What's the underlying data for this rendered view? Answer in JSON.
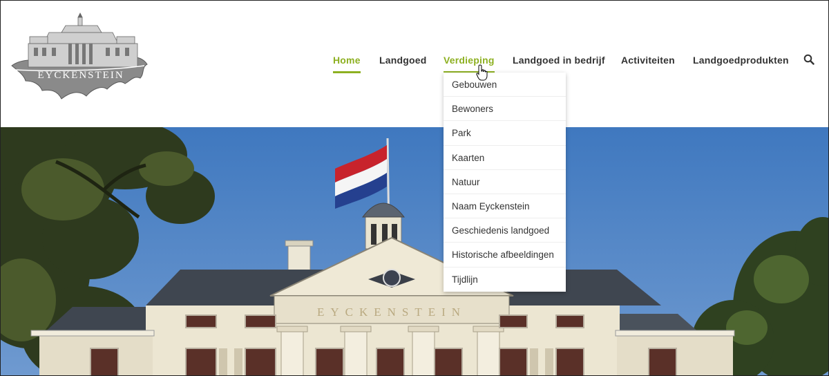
{
  "logo": {
    "text": "EYCKENSTEIN"
  },
  "nav": {
    "items": [
      {
        "label": "Home",
        "active": true
      },
      {
        "label": "Landgoed",
        "active": false
      },
      {
        "label": "Verdieping",
        "active": true
      },
      {
        "label": "Landgoed in bedrijf",
        "active": false
      },
      {
        "label": "Activiteiten",
        "active": false
      },
      {
        "label": "Landgoedprodukten",
        "active": false
      }
    ],
    "search_icon": "search-icon"
  },
  "dropdown": {
    "items": [
      "Gebouwen",
      "Bewoners",
      "Park",
      "Kaarten",
      "Natuur",
      "Naam Eyckenstein",
      "Geschiedenis landgoed",
      "Historische afbeeldingen",
      "Tijdlijn"
    ]
  },
  "hero": {
    "pediment_text": "EYCKENSTEIN"
  },
  "colors": {
    "accent": "#8db021",
    "text": "#333333",
    "sky": "#4a7fc1"
  }
}
